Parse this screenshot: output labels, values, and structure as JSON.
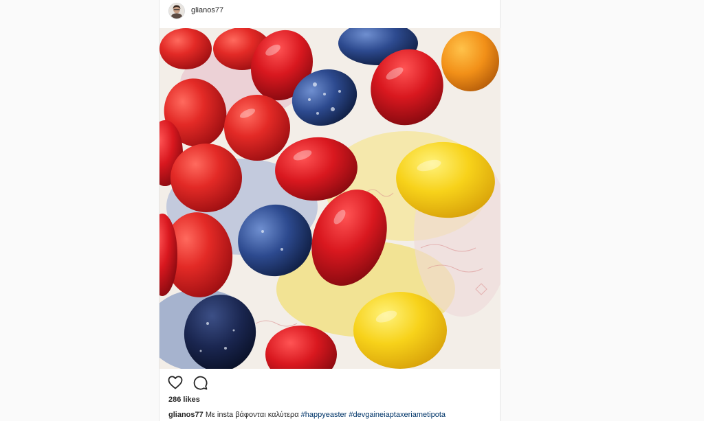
{
  "post": {
    "username": "glianos77",
    "avatar_icon": "profile-avatar",
    "likes_count": "286",
    "likes_label": "likes",
    "caption_text": "Με insta βάφονται καλύτερα",
    "hashtags": [
      "#happyeaster",
      "#devgaineiaptaxeriametipota"
    ]
  },
  "icons": {
    "like": "heart-icon",
    "comment": "comment-bubble-icon"
  },
  "colors": {
    "background": "#fafafa",
    "card": "#ffffff",
    "text": "#262626",
    "hashtag": "#003569"
  }
}
